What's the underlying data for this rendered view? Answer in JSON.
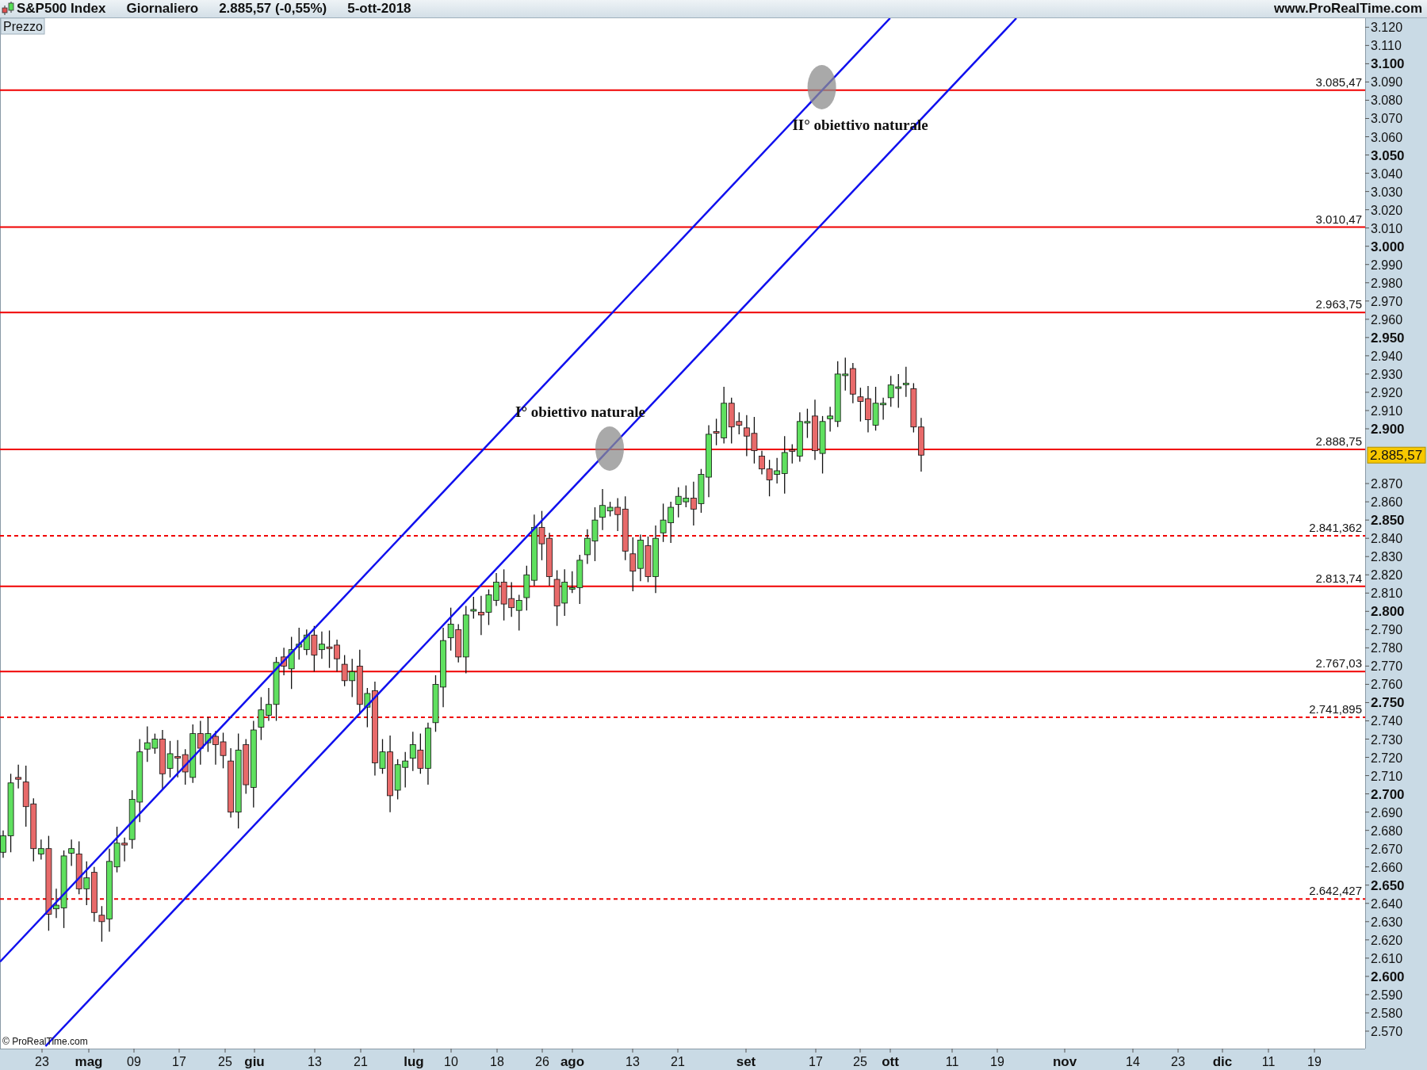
{
  "header": {
    "title": "S&P500 Index",
    "period": "Giornaliero",
    "quote": "2.885,57 (-0,55%)",
    "date": "5-ott-2018",
    "site": "www.ProRealTime.com"
  },
  "panel": {
    "label": "Prezzo"
  },
  "chart": {
    "levels": [
      {
        "label": "3.085,47",
        "kind": "solid"
      },
      {
        "label": "3.010,47",
        "kind": "solid"
      },
      {
        "label": "2.963,75",
        "kind": "solid"
      },
      {
        "label": "2.888,75",
        "kind": "solid"
      },
      {
        "label": "2.841,362",
        "kind": "dashed"
      },
      {
        "label": "2.813,74",
        "kind": "solid"
      },
      {
        "label": "2.767,03",
        "kind": "solid"
      },
      {
        "label": "2.741,895",
        "kind": "dashed"
      },
      {
        "label": "2.642,427",
        "kind": "dashed"
      }
    ],
    "annotations": [
      "II° obiettivo naturale",
      "I° obiettivo naturale"
    ],
    "price_tag": "2.885,57",
    "copyright": "© ProRealTime.com"
  },
  "price_axis": {
    "ticks": [
      {
        "label": "3.120",
        "kind": "minor"
      },
      {
        "label": "3.110",
        "kind": "minor"
      },
      {
        "label": "3.100",
        "kind": "major"
      },
      {
        "label": "3.090",
        "kind": "minor"
      },
      {
        "label": "3.080",
        "kind": "minor"
      },
      {
        "label": "3.070",
        "kind": "minor"
      },
      {
        "label": "3.060",
        "kind": "minor"
      },
      {
        "label": "3.050",
        "kind": "major"
      },
      {
        "label": "3.040",
        "kind": "minor"
      },
      {
        "label": "3.030",
        "kind": "minor"
      },
      {
        "label": "3.020",
        "kind": "minor"
      },
      {
        "label": "3.010",
        "kind": "minor"
      },
      {
        "label": "3.000",
        "kind": "major"
      },
      {
        "label": "2.990",
        "kind": "minor"
      },
      {
        "label": "2.980",
        "kind": "minor"
      },
      {
        "label": "2.970",
        "kind": "minor"
      },
      {
        "label": "2.960",
        "kind": "minor"
      },
      {
        "label": "2.950",
        "kind": "major"
      },
      {
        "label": "2.940",
        "kind": "minor"
      },
      {
        "label": "2.930",
        "kind": "minor"
      },
      {
        "label": "2.920",
        "kind": "minor"
      },
      {
        "label": "2.910",
        "kind": "minor"
      },
      {
        "label": "2.900",
        "kind": "major"
      },
      {
        "label": "2.870",
        "kind": "minor"
      },
      {
        "label": "2.860",
        "kind": "minor"
      },
      {
        "label": "2.850",
        "kind": "major"
      },
      {
        "label": "2.840",
        "kind": "minor"
      },
      {
        "label": "2.830",
        "kind": "minor"
      },
      {
        "label": "2.820",
        "kind": "minor"
      },
      {
        "label": "2.810",
        "kind": "minor"
      },
      {
        "label": "2.800",
        "kind": "major"
      },
      {
        "label": "2.790",
        "kind": "minor"
      },
      {
        "label": "2.780",
        "kind": "minor"
      },
      {
        "label": "2.770",
        "kind": "minor"
      },
      {
        "label": "2.760",
        "kind": "minor"
      },
      {
        "label": "2.750",
        "kind": "major"
      },
      {
        "label": "2.740",
        "kind": "minor"
      },
      {
        "label": "2.730",
        "kind": "minor"
      },
      {
        "label": "2.720",
        "kind": "minor"
      },
      {
        "label": "2.710",
        "kind": "minor"
      },
      {
        "label": "2.700",
        "kind": "major"
      },
      {
        "label": "2.690",
        "kind": "minor"
      },
      {
        "label": "2.680",
        "kind": "minor"
      },
      {
        "label": "2.670",
        "kind": "minor"
      },
      {
        "label": "2.660",
        "kind": "minor"
      },
      {
        "label": "2.650",
        "kind": "major"
      },
      {
        "label": "2.640",
        "kind": "minor"
      },
      {
        "label": "2.630",
        "kind": "minor"
      },
      {
        "label": "2.620",
        "kind": "minor"
      },
      {
        "label": "2.610",
        "kind": "minor"
      },
      {
        "label": "2.600",
        "kind": "major"
      },
      {
        "label": "2.590",
        "kind": "minor"
      },
      {
        "label": "2.580",
        "kind": "minor"
      },
      {
        "label": "2.570",
        "kind": "minor"
      }
    ]
  },
  "time_axis": {
    "labels": [
      {
        "label": "23",
        "kind": "day"
      },
      {
        "label": "mag",
        "kind": "month"
      },
      {
        "label": "09",
        "kind": "day"
      },
      {
        "label": "17",
        "kind": "day"
      },
      {
        "label": "25",
        "kind": "day"
      },
      {
        "label": "giu",
        "kind": "month"
      },
      {
        "label": "13",
        "kind": "day"
      },
      {
        "label": "21",
        "kind": "day"
      },
      {
        "label": "lug",
        "kind": "month"
      },
      {
        "label": "10",
        "kind": "day"
      },
      {
        "label": "18",
        "kind": "day"
      },
      {
        "label": "26",
        "kind": "day"
      },
      {
        "label": "ago",
        "kind": "month"
      },
      {
        "label": "13",
        "kind": "day"
      },
      {
        "label": "21",
        "kind": "day"
      },
      {
        "label": "set",
        "kind": "month"
      },
      {
        "label": "17",
        "kind": "day"
      },
      {
        "label": "25",
        "kind": "day"
      },
      {
        "label": "ott",
        "kind": "month"
      },
      {
        "label": "11",
        "kind": "day"
      },
      {
        "label": "19",
        "kind": "day"
      },
      {
        "label": "nov",
        "kind": "month"
      },
      {
        "label": "14",
        "kind": "day"
      },
      {
        "label": "23",
        "kind": "day"
      },
      {
        "label": "dic",
        "kind": "month"
      },
      {
        "label": "11",
        "kind": "day"
      },
      {
        "label": "19",
        "kind": "day"
      }
    ]
  }
}
